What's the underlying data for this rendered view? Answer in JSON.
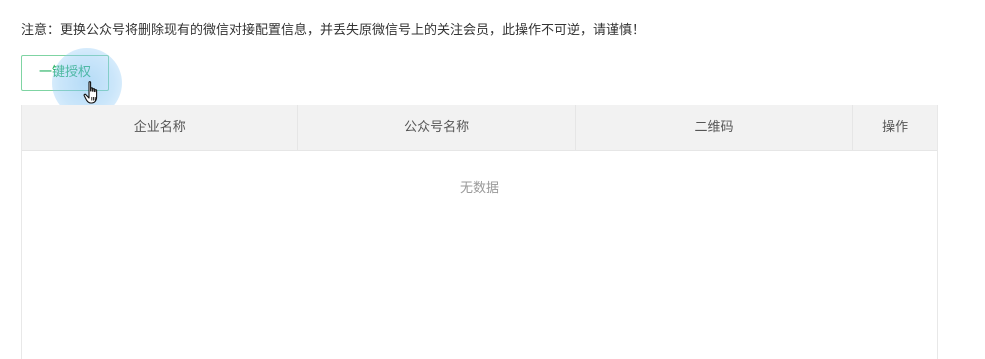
{
  "notice": {
    "text": "注意：更换公众号将删除现有的微信对接配置信息，并丢失原微信号上的关注会员，此操作不可逆，请谨慎！"
  },
  "toolbar": {
    "authorize_label": "一键授权"
  },
  "table": {
    "columns": [
      "企业名称",
      "公众号名称",
      "二维码",
      "操作"
    ],
    "rows": [],
    "empty_text": "无数据"
  },
  "colors": {
    "accent": "#1aad5a",
    "button_border": "#7fd4a3",
    "header_bg": "#f2f2f2",
    "muted_text": "#999999"
  },
  "icons": {
    "cursor": "hand-pointer-icon"
  }
}
